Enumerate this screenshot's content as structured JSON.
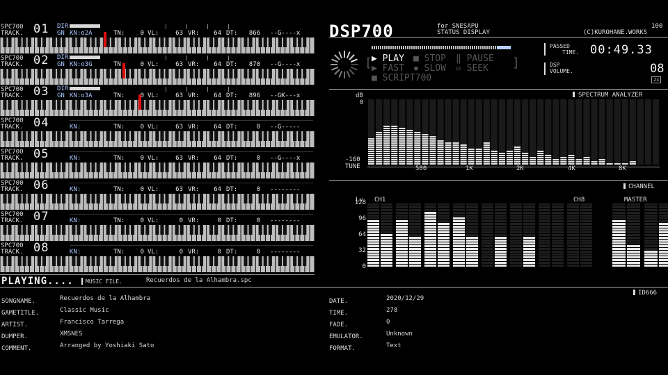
{
  "channels": [
    {
      "label1": "SPC700",
      "label2": "TRACK.",
      "num": "01",
      "dir": "DIR",
      "gn": "GN",
      "kn_label": "KN:",
      "kn": "o2A",
      "tn_label": "TN:",
      "tn": "0",
      "vl_label": "VL:",
      "vl": "63",
      "vr_label": "VR:",
      "vr": "64",
      "dt_label": "DT:",
      "dt": "866",
      "env": "--G----x",
      "active": true,
      "level": 0.46,
      "key_pos": 0.33
    },
    {
      "label1": "SPC700",
      "label2": "TRACK.",
      "num": "02",
      "dir": "DIR",
      "gn": "GN",
      "kn_label": "KN:",
      "kn": "o3G",
      "tn_label": "TN:",
      "tn": "0",
      "vl_label": "VL:",
      "vl": "63",
      "vr_label": "VR:",
      "vr": "64",
      "dt_label": "DT:",
      "dt": "870",
      "env": "--G----x",
      "active": true,
      "level": 0.46,
      "key_pos": 0.39
    },
    {
      "label1": "SPC700",
      "label2": "TRACK.",
      "num": "03",
      "dir": "DIR",
      "gn": "GN",
      "kn_label": "KN:",
      "kn": "o3A",
      "tn_label": "TN:",
      "tn": "0",
      "vl_label": "VL:",
      "vl": "63",
      "vr_label": "VR:",
      "vr": "64",
      "dt_label": "DT:",
      "dt": "896",
      "env": "--GK---x",
      "active": true,
      "level": 0.46,
      "key_pos": 0.44
    },
    {
      "label1": "SPC700",
      "label2": "TRACK.",
      "num": "04",
      "dir": "",
      "gn": "",
      "kn_label": "KN:",
      "kn": "",
      "tn_label": "TN:",
      "tn": "0",
      "vl_label": "VL:",
      "vl": "63",
      "vr_label": "VR:",
      "vr": "64",
      "dt_label": "DT:",
      "dt": "0",
      "env": "--G-----",
      "active": false,
      "level": 0,
      "key_pos": null
    },
    {
      "label1": "SPC700",
      "label2": "TRACK.",
      "num": "05",
      "dir": "",
      "gn": "",
      "kn_label": "KN:",
      "kn": "",
      "tn_label": "TN:",
      "tn": "0",
      "vl_label": "VL:",
      "vl": "63",
      "vr_label": "VR:",
      "vr": "64",
      "dt_label": "DT:",
      "dt": "0",
      "env": "--G----x",
      "active": false,
      "level": 0,
      "key_pos": null
    },
    {
      "label1": "SPC700",
      "label2": "TRACK.",
      "num": "06",
      "dir": "",
      "gn": "",
      "kn_label": "KN:",
      "kn": "",
      "tn_label": "TN:",
      "tn": "0",
      "vl_label": "VL:",
      "vl": "63",
      "vr_label": "VR:",
      "vr": "64",
      "dt_label": "DT:",
      "dt": "0",
      "env": "--------",
      "active": false,
      "level": 0,
      "key_pos": null
    },
    {
      "label1": "SPC700",
      "label2": "TRACK.",
      "num": "07",
      "dir": "",
      "gn": "",
      "kn_label": "KN:",
      "kn": "",
      "tn_label": "TN:",
      "tn": "0",
      "vl_label": "VL:",
      "vl": "0",
      "vr_label": "VR:",
      "vr": "0",
      "dt_label": "DT:",
      "dt": "0",
      "env": "--------",
      "active": false,
      "level": 0,
      "key_pos": null
    },
    {
      "label1": "SPC700",
      "label2": "TRACK.",
      "num": "08",
      "dir": "",
      "gn": "",
      "kn_label": "KN:",
      "kn": "",
      "tn_label": "TN:",
      "tn": "0",
      "vl_label": "VL:",
      "vl": "0",
      "vr_label": "VR:",
      "vr": "0",
      "dt_label": "DT:",
      "dt": "0",
      "env": "--------",
      "active": false,
      "level": 0,
      "key_pos": null
    }
  ],
  "status": {
    "playing": "PLAYING....",
    "music_file_label": "MUSIC FILE.",
    "music_file": "Recuerdos de la Alhambra.spc"
  },
  "header": {
    "logo": "DSP700",
    "for": "for SNESAPU",
    "status": "STATUS DISPLAY",
    "version": "100",
    "copyright": "(C)KUROHANE.WORKS"
  },
  "controls": {
    "play": "PLAY",
    "stop": "STOP",
    "pause": "PAUSE",
    "fast": "FAST",
    "slow": "SLOW",
    "seek": "SEEK",
    "script": "SCRIPT700"
  },
  "passed": {
    "label1": "PASSED",
    "label2": "TIME.",
    "value": "00:49.33"
  },
  "volume": {
    "label1": "DSP",
    "label2": "VOLUME.",
    "value": "08",
    "badge": "2x"
  },
  "spectrum": {
    "title": "SPECTRUM ANALYZER",
    "db": "dB",
    "zero": "0",
    "min": "-160",
    "tune": "TUNE",
    "ticks": [
      "500",
      "1K",
      "2K",
      "4K",
      "8K"
    ]
  },
  "channel_meter": {
    "title": "CHANNEL",
    "lv": "Lv",
    "ch1": "CH1",
    "ch8": "CH8",
    "master": "MASTER",
    "yticks": [
      "128",
      "96",
      "64",
      "32",
      "0"
    ]
  },
  "id": "ID666",
  "fields_left": [
    {
      "label": "SONGNAME.",
      "value": "Recuerdos de la Alhambra"
    },
    {
      "label": "GAMETITLE.",
      "value": "Classic Music"
    },
    {
      "label": "ARTIST.",
      "value": "Francisco Tarrega"
    },
    {
      "label": "DUMPER.",
      "value": "XMSNES"
    },
    {
      "label": "COMMENT.",
      "value": "Arranged by Yoshiaki Sato"
    }
  ],
  "fields_right": [
    {
      "label": "DATE.",
      "value": "2020/12/29"
    },
    {
      "label": "TIME.",
      "value": "278"
    },
    {
      "label": "FADE.",
      "value": "0"
    },
    {
      "label": "EMULATOR.",
      "value": "Unknown"
    },
    {
      "label": "FORMAT.",
      "value": "Text"
    }
  ],
  "chart_data": [
    {
      "type": "bar",
      "title": "SPECTRUM ANALYZER",
      "ylabel": "dB",
      "ylim": [
        -160,
        0
      ],
      "values": [
        -95,
        -80,
        -68,
        -66,
        -70,
        -74,
        -82,
        -88,
        -92,
        -100,
        -108,
        -108,
        -112,
        -120,
        -124,
        -104,
        -126,
        -134,
        -128,
        -118,
        -132,
        -140,
        -128,
        -136,
        -146,
        -140,
        -136,
        -146,
        -144,
        -150,
        -148,
        -156,
        -158,
        -158,
        -152,
        -160,
        -160,
        -160
      ]
    },
    {
      "type": "bar",
      "title": "CHANNEL",
      "ylabel": "Lv",
      "ylim": [
        0,
        128
      ],
      "categories": [
        "CH1",
        "CH2",
        "CH3",
        "CH4",
        "CH5",
        "CH6",
        "CH7",
        "CH8",
        "MASTER L",
        "MASTER R"
      ],
      "series": [
        {
          "values": [
            [
              90,
              66
            ],
            [
              92,
              56
            ],
            [
              108,
              88
            ],
            [
              98,
              58
            ],
            [
              0,
              58
            ],
            [
              0,
              58
            ],
            [
              0,
              0
            ],
            [
              0,
              0
            ],
            [
              92,
              44
            ],
            [
              28,
              84
            ]
          ]
        }
      ]
    }
  ]
}
